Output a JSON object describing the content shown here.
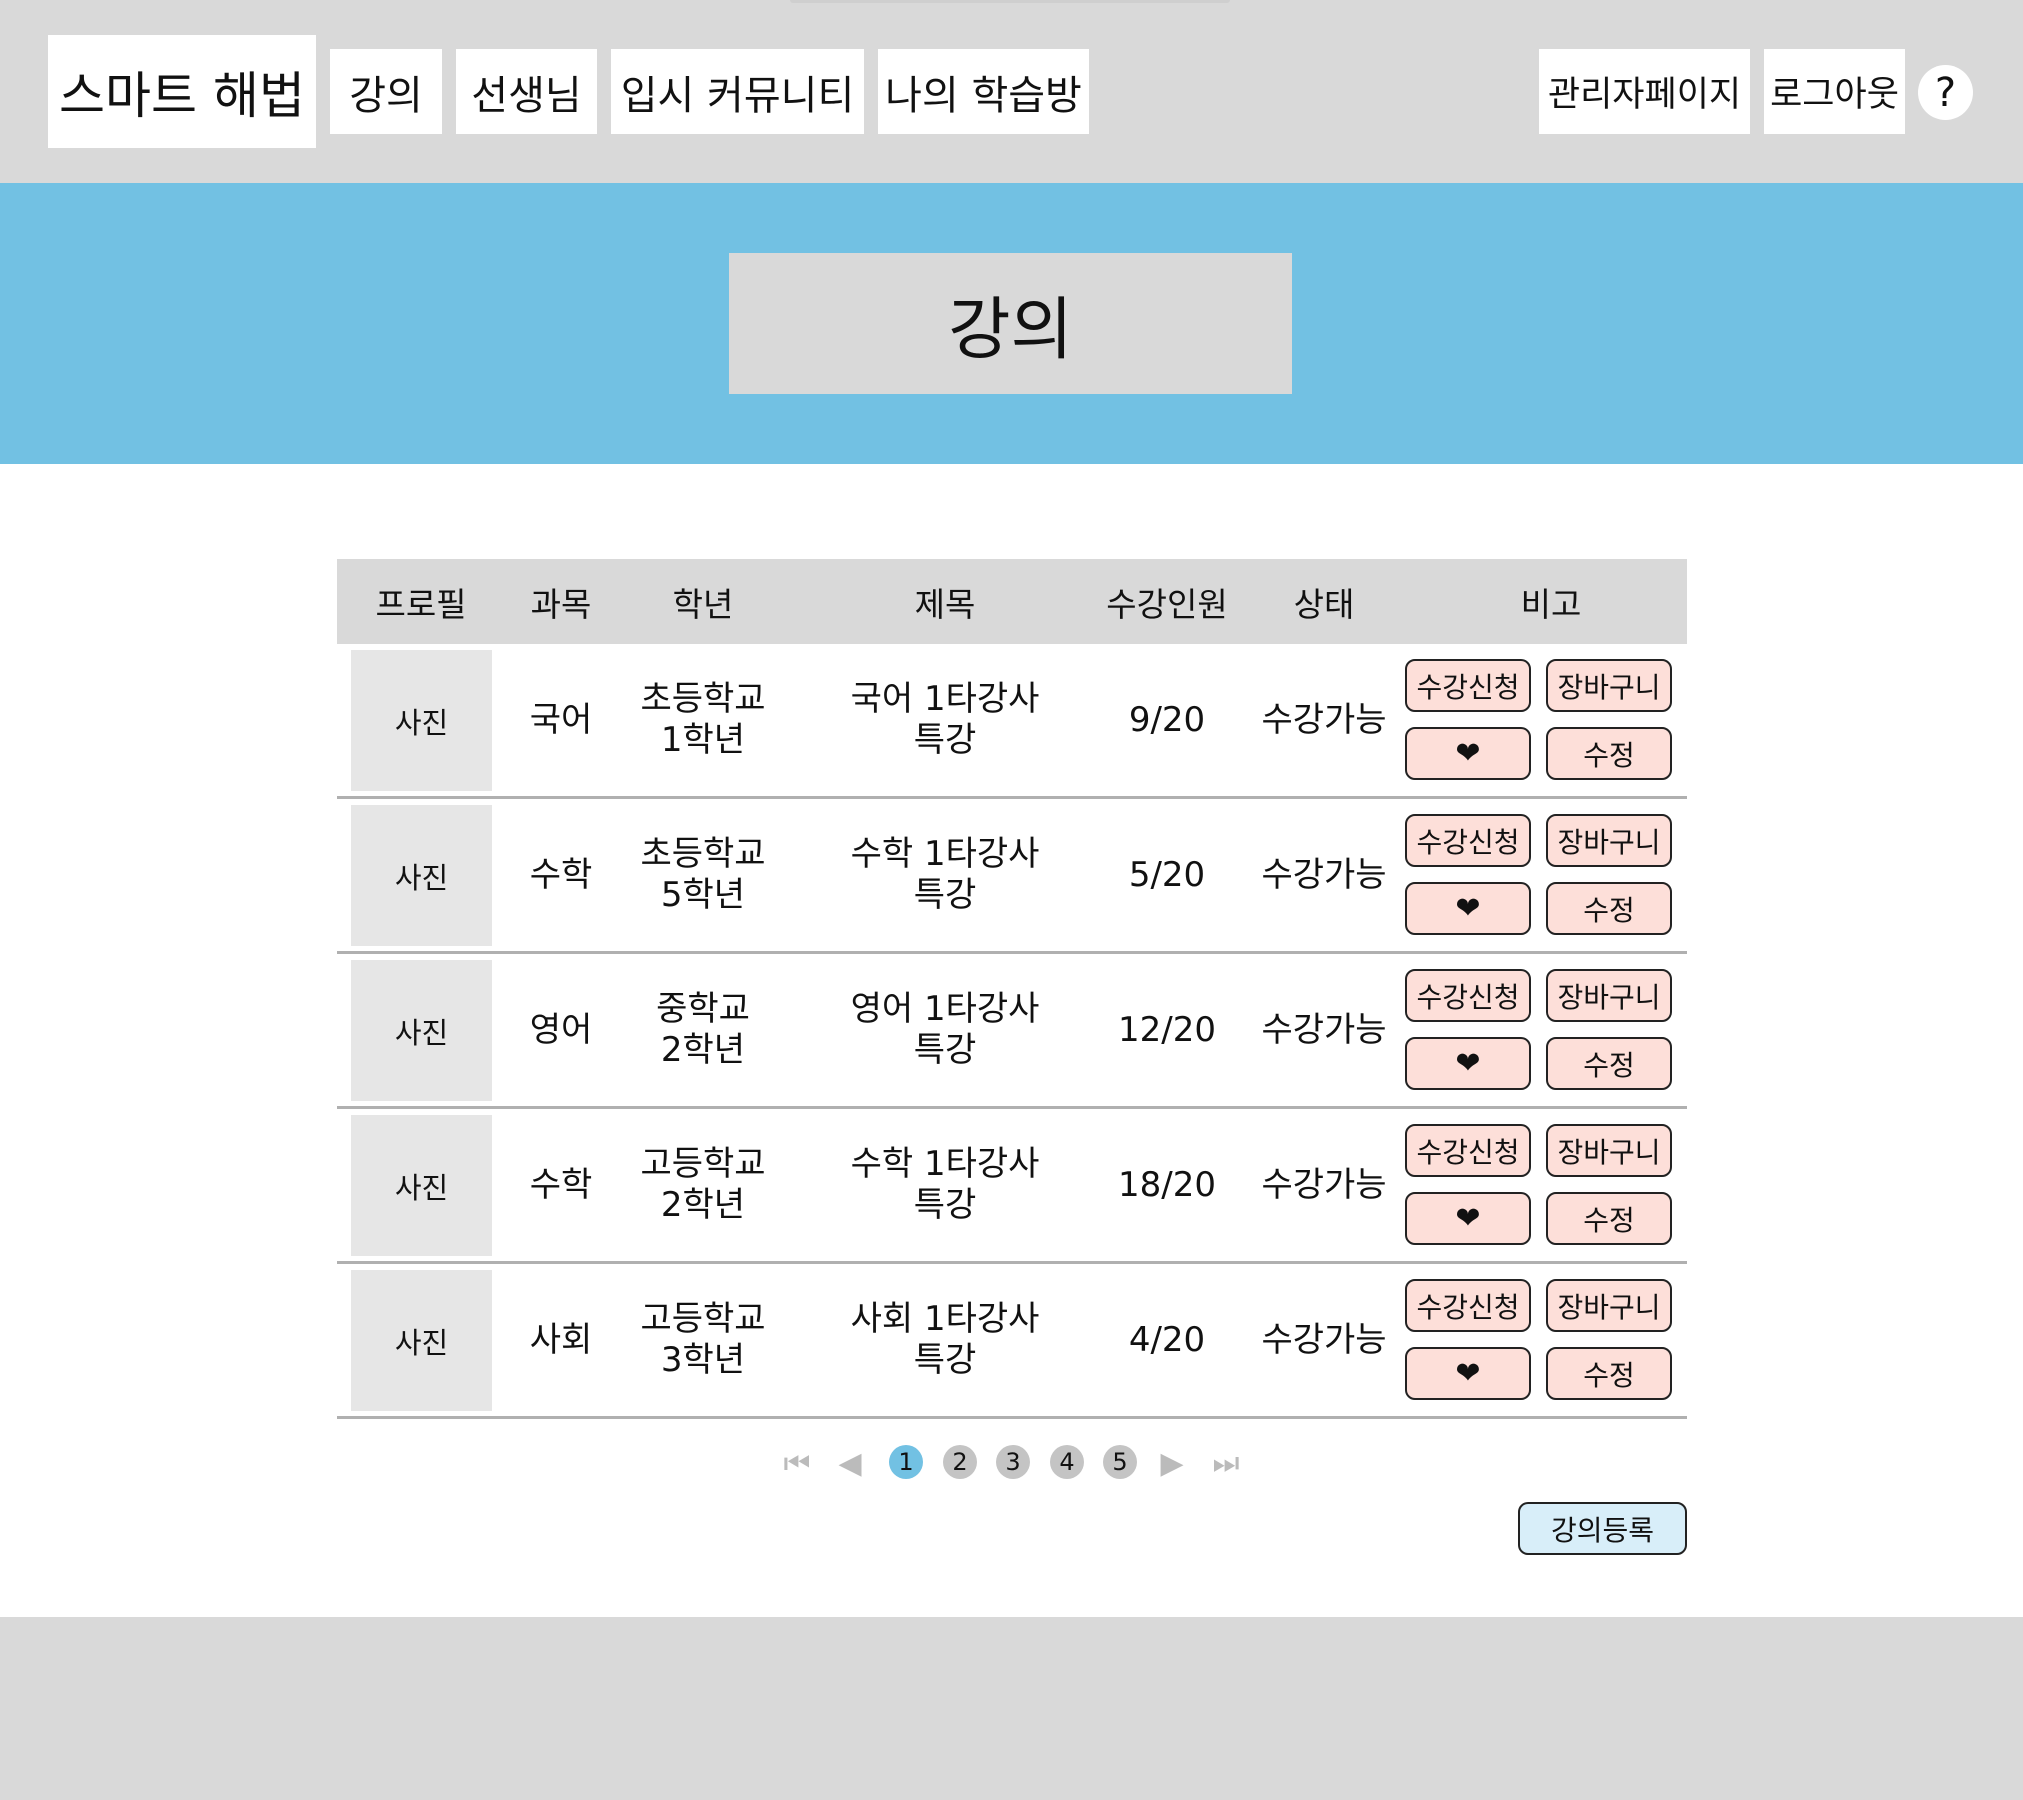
{
  "header": {
    "logo": "스마트 해법",
    "nav": [
      "강의",
      "선생님",
      "입시 커뮤니티",
      "나의 학습방"
    ],
    "admin": "관리자페이지",
    "logout": "로그아웃",
    "help": "?"
  },
  "hero": {
    "title": "강의"
  },
  "table": {
    "columns": [
      "프로필",
      "과목",
      "학년",
      "제목",
      "수강인원",
      "상태",
      "비고"
    ],
    "rows": [
      {
        "photo": "사진",
        "subject": "국어",
        "grade_school": "초등학교",
        "grade_year": "1학년",
        "title_line1": "국어 1타강사",
        "title_line2": "특강",
        "count": "9/20",
        "status": "수강가능"
      },
      {
        "photo": "사진",
        "subject": "수학",
        "grade_school": "초등학교",
        "grade_year": "5학년",
        "title_line1": "수학 1타강사",
        "title_line2": "특강",
        "count": "5/20",
        "status": "수강가능"
      },
      {
        "photo": "사진",
        "subject": "영어",
        "grade_school": "중학교",
        "grade_year": "2학년",
        "title_line1": "영어 1타강사",
        "title_line2": "특강",
        "count": "12/20",
        "status": "수강가능"
      },
      {
        "photo": "사진",
        "subject": "수학",
        "grade_school": "고등학교",
        "grade_year": "2학년",
        "title_line1": "수학 1타강사",
        "title_line2": "특강",
        "count": "18/20",
        "status": "수강가능"
      },
      {
        "photo": "사진",
        "subject": "사회",
        "grade_school": "고등학교",
        "grade_year": "3학년",
        "title_line1": "사회 1타강사",
        "title_line2": "특강",
        "count": "4/20",
        "status": "수강가능"
      }
    ],
    "actions": {
      "apply": "수강신청",
      "cart": "장바구니",
      "like": "❤",
      "edit": "수정"
    }
  },
  "pagination": {
    "pages": [
      "1",
      "2",
      "3",
      "4",
      "5"
    ],
    "current": "1",
    "first": "⏮",
    "prev": "◀",
    "next": "▶",
    "last": "⏭"
  },
  "register_button": "강의등록",
  "colors": {
    "nav_bg": "#d9d9d9",
    "hero_bg": "#72c1e3",
    "action_btn": "#fddfd9",
    "register_btn": "#d8eef9",
    "page_active": "#72c1e3"
  }
}
